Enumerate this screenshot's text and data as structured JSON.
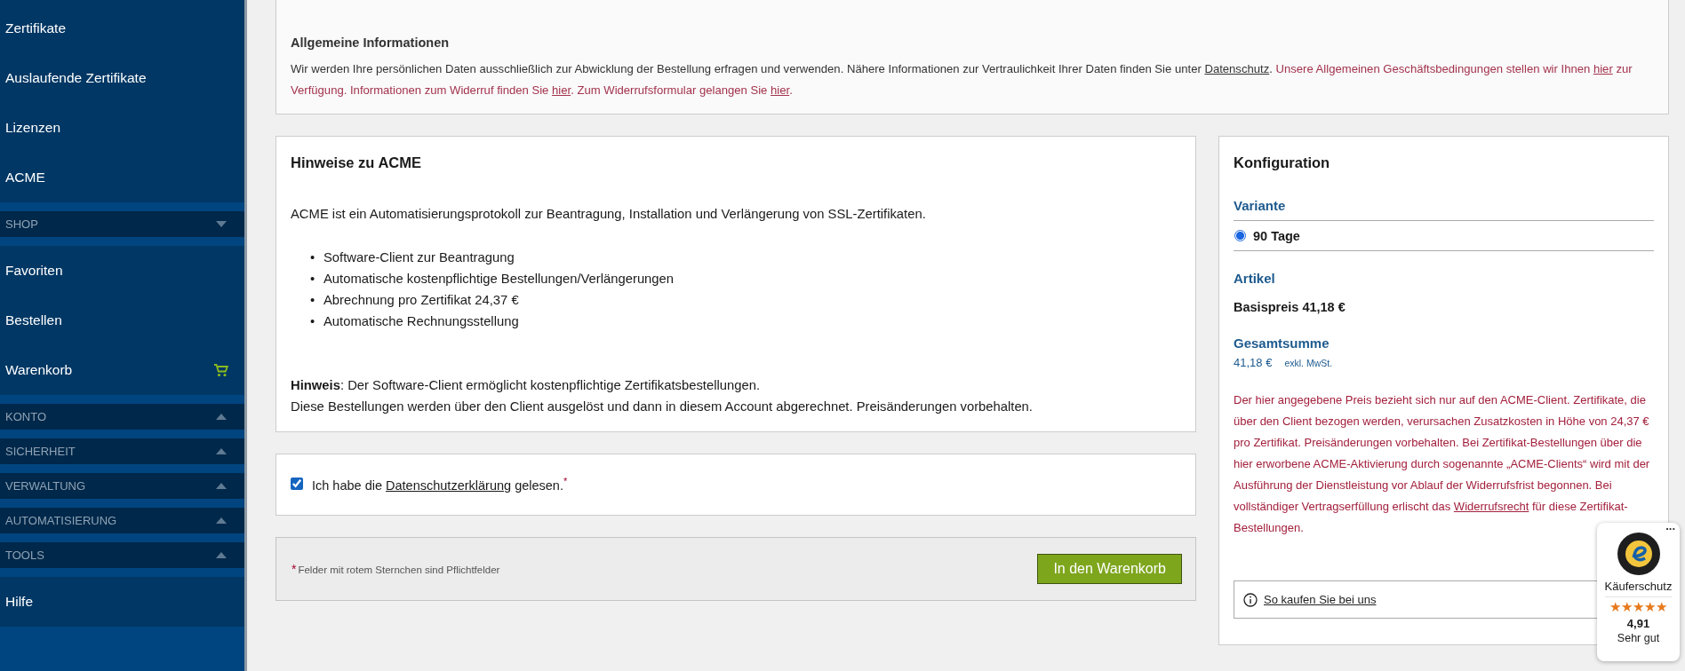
{
  "sidebar": {
    "sections": [
      {
        "kind": "links",
        "items": [
          {
            "kind": "plain",
            "label": "Zertifikate"
          },
          {
            "kind": "plain",
            "label": "Auslaufende Zertifikate"
          },
          {
            "kind": "plain",
            "label": "Lizenzen"
          },
          {
            "kind": "plain",
            "label": "ACME"
          }
        ]
      },
      {
        "kind": "header",
        "label": "SHOP",
        "expanded": true
      },
      {
        "kind": "links",
        "items": [
          {
            "kind": "plain",
            "label": "Favoriten"
          },
          {
            "kind": "plain",
            "label": "Bestellen"
          },
          {
            "kind": "cart",
            "label": "Warenkorb"
          }
        ]
      },
      {
        "kind": "header",
        "label": "KONTO",
        "expanded": false
      },
      {
        "kind": "header",
        "label": "SICHERHEIT",
        "expanded": false
      },
      {
        "kind": "header",
        "label": "VERWALTUNG",
        "expanded": false
      },
      {
        "kind": "header",
        "label": "AUTOMATISIERUNG",
        "expanded": false
      },
      {
        "kind": "header",
        "label": "TOOLS",
        "expanded": false
      },
      {
        "kind": "links",
        "items": [
          {
            "kind": "plain",
            "label": "Hilfe"
          }
        ]
      }
    ]
  },
  "general_info": {
    "title": "Allgemeine Informationen",
    "segments": [
      {
        "kind": "text",
        "text": "Wir werden Ihre persönlichen Daten ausschließlich zur Abwicklung der Bestellung erfragen und verwenden. Nähere Informationen zur Vertraulichkeit Ihrer Daten finden Sie unter "
      },
      {
        "kind": "link",
        "text": "Datenschutz"
      },
      {
        "kind": "text",
        "text": ". "
      },
      {
        "kind": "notice",
        "text": "Unsere Allgemeinen Geschäftsbedingungen stellen wir Ihnen "
      },
      {
        "kind": "notice_link",
        "text": "hier"
      },
      {
        "kind": "notice",
        "text": " zur Verfügung. Informationen zum Widerruf finden Sie "
      },
      {
        "kind": "notice_link",
        "text": "hier"
      },
      {
        "kind": "notice",
        "text": ". Zum Widerrufsformular gelangen Sie "
      },
      {
        "kind": "notice_link",
        "text": "hier"
      },
      {
        "kind": "notice",
        "text": "."
      }
    ]
  },
  "acme_notes": {
    "title": "Hinweise zu ACME",
    "intro": "ACME ist ein Automatisierungsprotokoll zur Beantragung, Installation und Verlängerung von SSL-Zertifikaten.",
    "bullets": [
      {
        "marker": "•",
        "text": "Software-Client zur Beantragung"
      },
      {
        "marker": "•",
        "text": "Automatische kostenpflichtige Bestellungen/Verlängerungen"
      },
      {
        "marker": "•",
        "text": "Abrechnung pro Zertifikat 24,37 €"
      },
      {
        "marker": "•",
        "text": "Automatische Rechnungsstellung"
      }
    ],
    "note_lines": [
      "**Hinweis**: Der Software-Client ermöglicht kostenpflichtige Zertifikatsbestellungen.",
      "Diese Bestellungen werden über den Client ausgelöst und dann in diesem Account abgerechnet. Preisänderungen vorbehalten."
    ]
  },
  "privacy_consent": {
    "checked": true,
    "segments": [
      {
        "kind": "text",
        "text": "Ich habe die "
      },
      {
        "kind": "link",
        "text": "Datenschutzerklärung"
      },
      {
        "kind": "text",
        "text": " gelesen."
      }
    ],
    "required_mark": "*"
  },
  "footer": {
    "required_mark": "*",
    "note": "Felder mit rotem Sternchen sind Pflichtfelder",
    "button": "In den Warenkorb"
  },
  "configuration": {
    "title": "Konfiguration",
    "variant_heading": "Variante",
    "variants": [
      {
        "label": "90 Tage",
        "selected": true
      }
    ],
    "article_heading": "Artikel",
    "base_price": "Basispreis 41,18 €",
    "total_heading": "Gesamtsumme",
    "total": "41,18 €",
    "tax_note": "exkl. MwSt.",
    "legal_segments": [
      {
        "kind": "text",
        "text": "Der hier angegebene Preis bezieht sich nur auf den ACME-Client. Zertifikate, die über den Client bezogen werden, verursachen Zusatzkosten in Höhe von 24,37 € pro Zertifikat. Preisänderungen vorbehalten. Bei Zertifikat-Bestellungen über die hier erworbene ACME-Aktivierung durch sogenannte „ACME-Clients“ wird mit der Ausführung der Dienstleistung vor Ablauf der Widerrufsfrist begonnen. Bei vollständiger Vertragserfüllung erlischt das "
      },
      {
        "kind": "link",
        "text": "Widerrufsrecht"
      },
      {
        "kind": "text",
        "text": " für diese Zertifikat-Bestellungen."
      }
    ],
    "how_to_buy": "So kaufen Sie bei uns"
  },
  "trust_badge": {
    "menu": "...",
    "label": "Käuferschutz",
    "stars": 5,
    "rating": "4,91",
    "verdict": "Sehr gut"
  }
}
